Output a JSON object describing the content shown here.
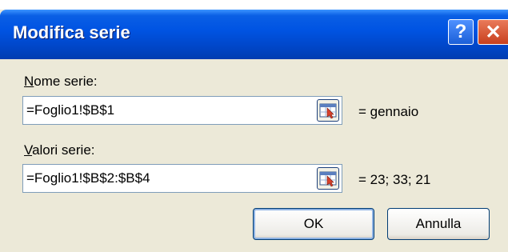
{
  "dialog": {
    "title": "Modifica serie",
    "help_glyph": "?",
    "close_glyph": "✕"
  },
  "name_field": {
    "label_accel": "N",
    "label_rest": "ome serie:",
    "value": "=Foglio1!$B$1",
    "preview": "= gennaio",
    "ref_icon": "range-select-icon"
  },
  "values_field": {
    "label_accel": "V",
    "label_rest": "alori serie:",
    "value": "=Foglio1!$B$2:$B$4",
    "preview": "= 23; 33; 21",
    "ref_icon": "range-select-icon"
  },
  "buttons": {
    "ok": "OK",
    "cancel": "Annulla"
  },
  "colors": {
    "titlebar": "#0054e3",
    "dialog_bg": "#ece9d8",
    "close": "#c8401e"
  }
}
